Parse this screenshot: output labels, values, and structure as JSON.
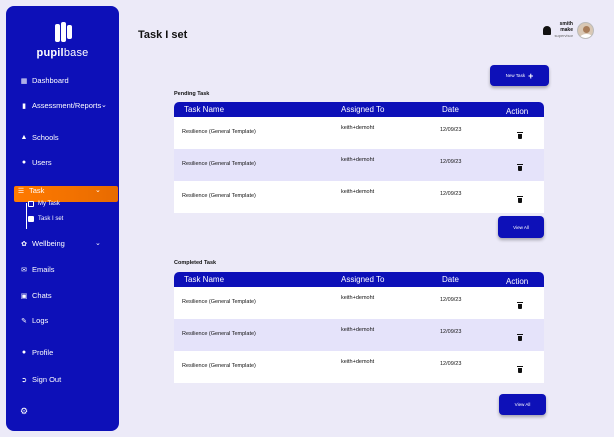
{
  "sidebar": {
    "logo": {
      "bold": "pupil",
      "thin": "base"
    },
    "items": [
      {
        "label": "Dashboard",
        "icon": "dashboard-grid-icon"
      },
      {
        "label": "Assessment/Reports",
        "icon": "report-icon"
      },
      {
        "label": "Schools",
        "icon": "school-icon"
      },
      {
        "label": "Users",
        "icon": "users-icon"
      },
      {
        "label": "Task",
        "icon": "list-icon",
        "active": true
      },
      {
        "label": "Wellbeing",
        "icon": "wellbeing-icon"
      },
      {
        "label": "Emails",
        "icon": "email-icon"
      },
      {
        "label": "Chats",
        "icon": "chat-icon"
      },
      {
        "label": "Logs",
        "icon": "logs-icon"
      },
      {
        "label": "Profile",
        "icon": "profile-icon"
      },
      {
        "label": "Sign Out",
        "icon": "sign-out-icon"
      }
    ],
    "task_sub": [
      {
        "label": "My Task"
      },
      {
        "label": "Task I set"
      }
    ]
  },
  "header": {
    "title": "Task I set",
    "user": {
      "first": "smith",
      "last": "make",
      "role": "supervisor"
    }
  },
  "new_task_label": "New Task",
  "view_all_label": "View All",
  "columns": [
    "Task Name",
    "Assigned To",
    "Date",
    "Action"
  ],
  "pending": {
    "label": "Pending Task",
    "rows": [
      {
        "task": "Resilience (General Template)",
        "assigned": "keith+demoht",
        "date": "12/09/23"
      },
      {
        "task": "Resilience (General Template)",
        "assigned": "keith+demoht",
        "date": "12/09/23"
      },
      {
        "task": "Resilience (General Template)",
        "assigned": "keith+demoht",
        "date": "12/09/23"
      }
    ]
  },
  "completed": {
    "label": "Completed Task",
    "rows": [
      {
        "task": "Resilience (General Template)",
        "assigned": "keith+demoht",
        "date": "12/09/23"
      },
      {
        "task": "Resilience (General Template)",
        "assigned": "keith+demoht",
        "date": "12/09/23"
      },
      {
        "task": "Resilience (General Template)",
        "assigned": "keith+demoht",
        "date": "12/09/23"
      }
    ]
  },
  "colors": {
    "primary": "#0d10b8",
    "accent": "#ff7a00",
    "background": "#eceaf8",
    "row_alt": "#e5e3fa"
  }
}
